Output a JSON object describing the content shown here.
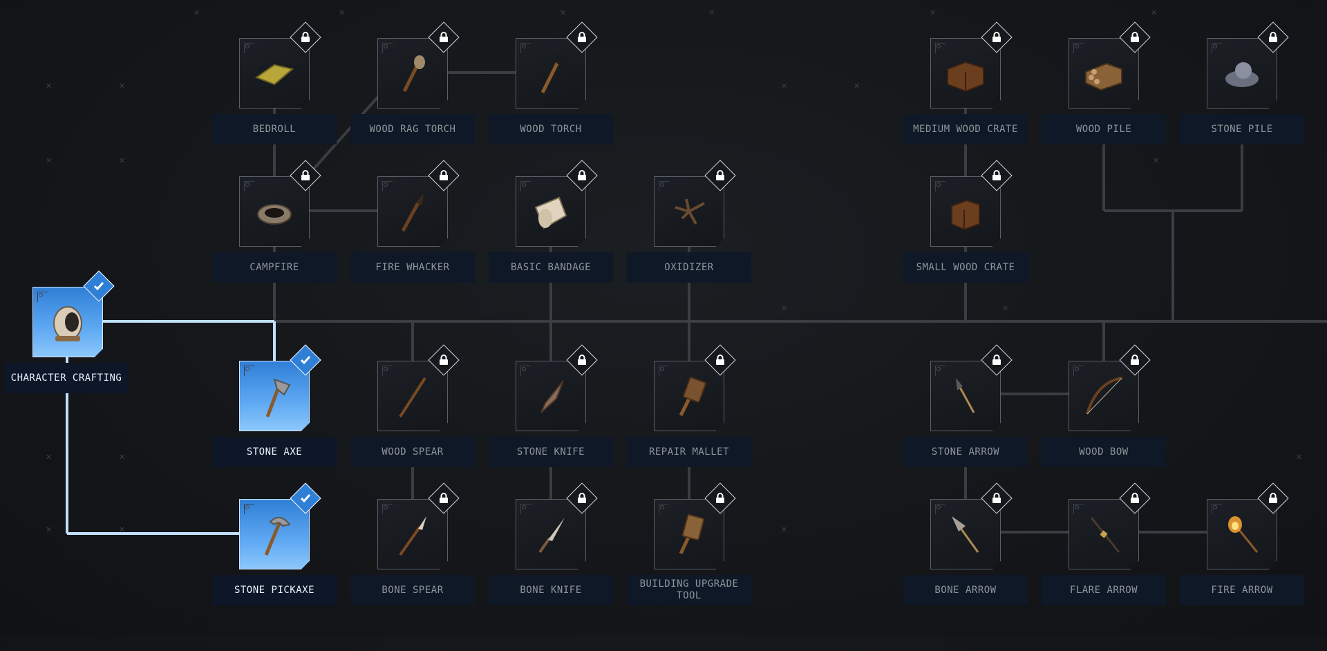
{
  "nodes": [
    {
      "id": "character-crafting",
      "label": "CHARACTER CRAFTING",
      "state": "unlocked",
      "icon": "helmet-icon"
    },
    {
      "id": "bedroll",
      "label": "BEDROLL",
      "state": "locked",
      "icon": "bedroll-icon"
    },
    {
      "id": "wood-rag-torch",
      "label": "WOOD RAG TORCH",
      "state": "locked",
      "icon": "rag-torch-icon"
    },
    {
      "id": "wood-torch",
      "label": "WOOD TORCH",
      "state": "locked",
      "icon": "torch-icon"
    },
    {
      "id": "medium-wood-crate",
      "label": "MEDIUM WOOD CRATE",
      "state": "locked",
      "icon": "crate-icon"
    },
    {
      "id": "wood-pile",
      "label": "WOOD PILE",
      "state": "locked",
      "icon": "wood-pile-icon"
    },
    {
      "id": "stone-pile",
      "label": "STONE PILE",
      "state": "locked",
      "icon": "stone-pile-icon"
    },
    {
      "id": "campfire",
      "label": "CAMPFIRE",
      "state": "locked",
      "icon": "campfire-icon"
    },
    {
      "id": "fire-whacker",
      "label": "FIRE WHACKER",
      "state": "locked",
      "icon": "fire-whacker-icon"
    },
    {
      "id": "basic-bandage",
      "label": "BASIC BANDAGE",
      "state": "locked",
      "icon": "bandage-icon"
    },
    {
      "id": "oxidizer",
      "label": "OXIDIZER",
      "state": "locked",
      "icon": "oxidizer-icon"
    },
    {
      "id": "small-wood-crate",
      "label": "SMALL WOOD CRATE",
      "state": "locked",
      "icon": "small-crate-icon"
    },
    {
      "id": "stone-axe",
      "label": "STONE AXE",
      "state": "unlocked",
      "icon": "axe-icon"
    },
    {
      "id": "wood-spear",
      "label": "WOOD SPEAR",
      "state": "locked",
      "icon": "spear-icon"
    },
    {
      "id": "stone-knife",
      "label": "STONE KNIFE",
      "state": "locked",
      "icon": "knife-icon"
    },
    {
      "id": "repair-mallet",
      "label": "REPAIR MALLET",
      "state": "locked",
      "icon": "mallet-icon"
    },
    {
      "id": "stone-arrow",
      "label": "STONE ARROW",
      "state": "locked",
      "icon": "arrow-icon"
    },
    {
      "id": "wood-bow",
      "label": "WOOD BOW",
      "state": "locked",
      "icon": "bow-icon"
    },
    {
      "id": "stone-pickaxe",
      "label": "STONE PICKAXE",
      "state": "unlocked",
      "icon": "pickaxe-icon"
    },
    {
      "id": "bone-spear",
      "label": "BONE SPEAR",
      "state": "locked",
      "icon": "bone-spear-icon"
    },
    {
      "id": "bone-knife",
      "label": "BONE KNIFE",
      "state": "locked",
      "icon": "bone-knife-icon"
    },
    {
      "id": "building-upgrade-tool",
      "label": "BUILDING UPGRADE TOOL",
      "state": "locked",
      "icon": "upgrade-tool-icon"
    },
    {
      "id": "bone-arrow",
      "label": "BONE ARROW",
      "state": "locked",
      "icon": "bone-arrow-icon"
    },
    {
      "id": "flare-arrow",
      "label": "FLARE ARROW",
      "state": "locked",
      "icon": "flare-arrow-icon"
    },
    {
      "id": "fire-arrow",
      "label": "FIRE ARROW",
      "state": "locked",
      "icon": "fire-arrow-icon"
    }
  ],
  "badges": {
    "locked": "lock-icon",
    "unlocked": "checkmark-icon"
  },
  "colors": {
    "unlocked_tile": "#5fa9f3",
    "active_line": "#bfe0ff",
    "inactive_line": "#3a3d42",
    "background": "#15171a"
  }
}
